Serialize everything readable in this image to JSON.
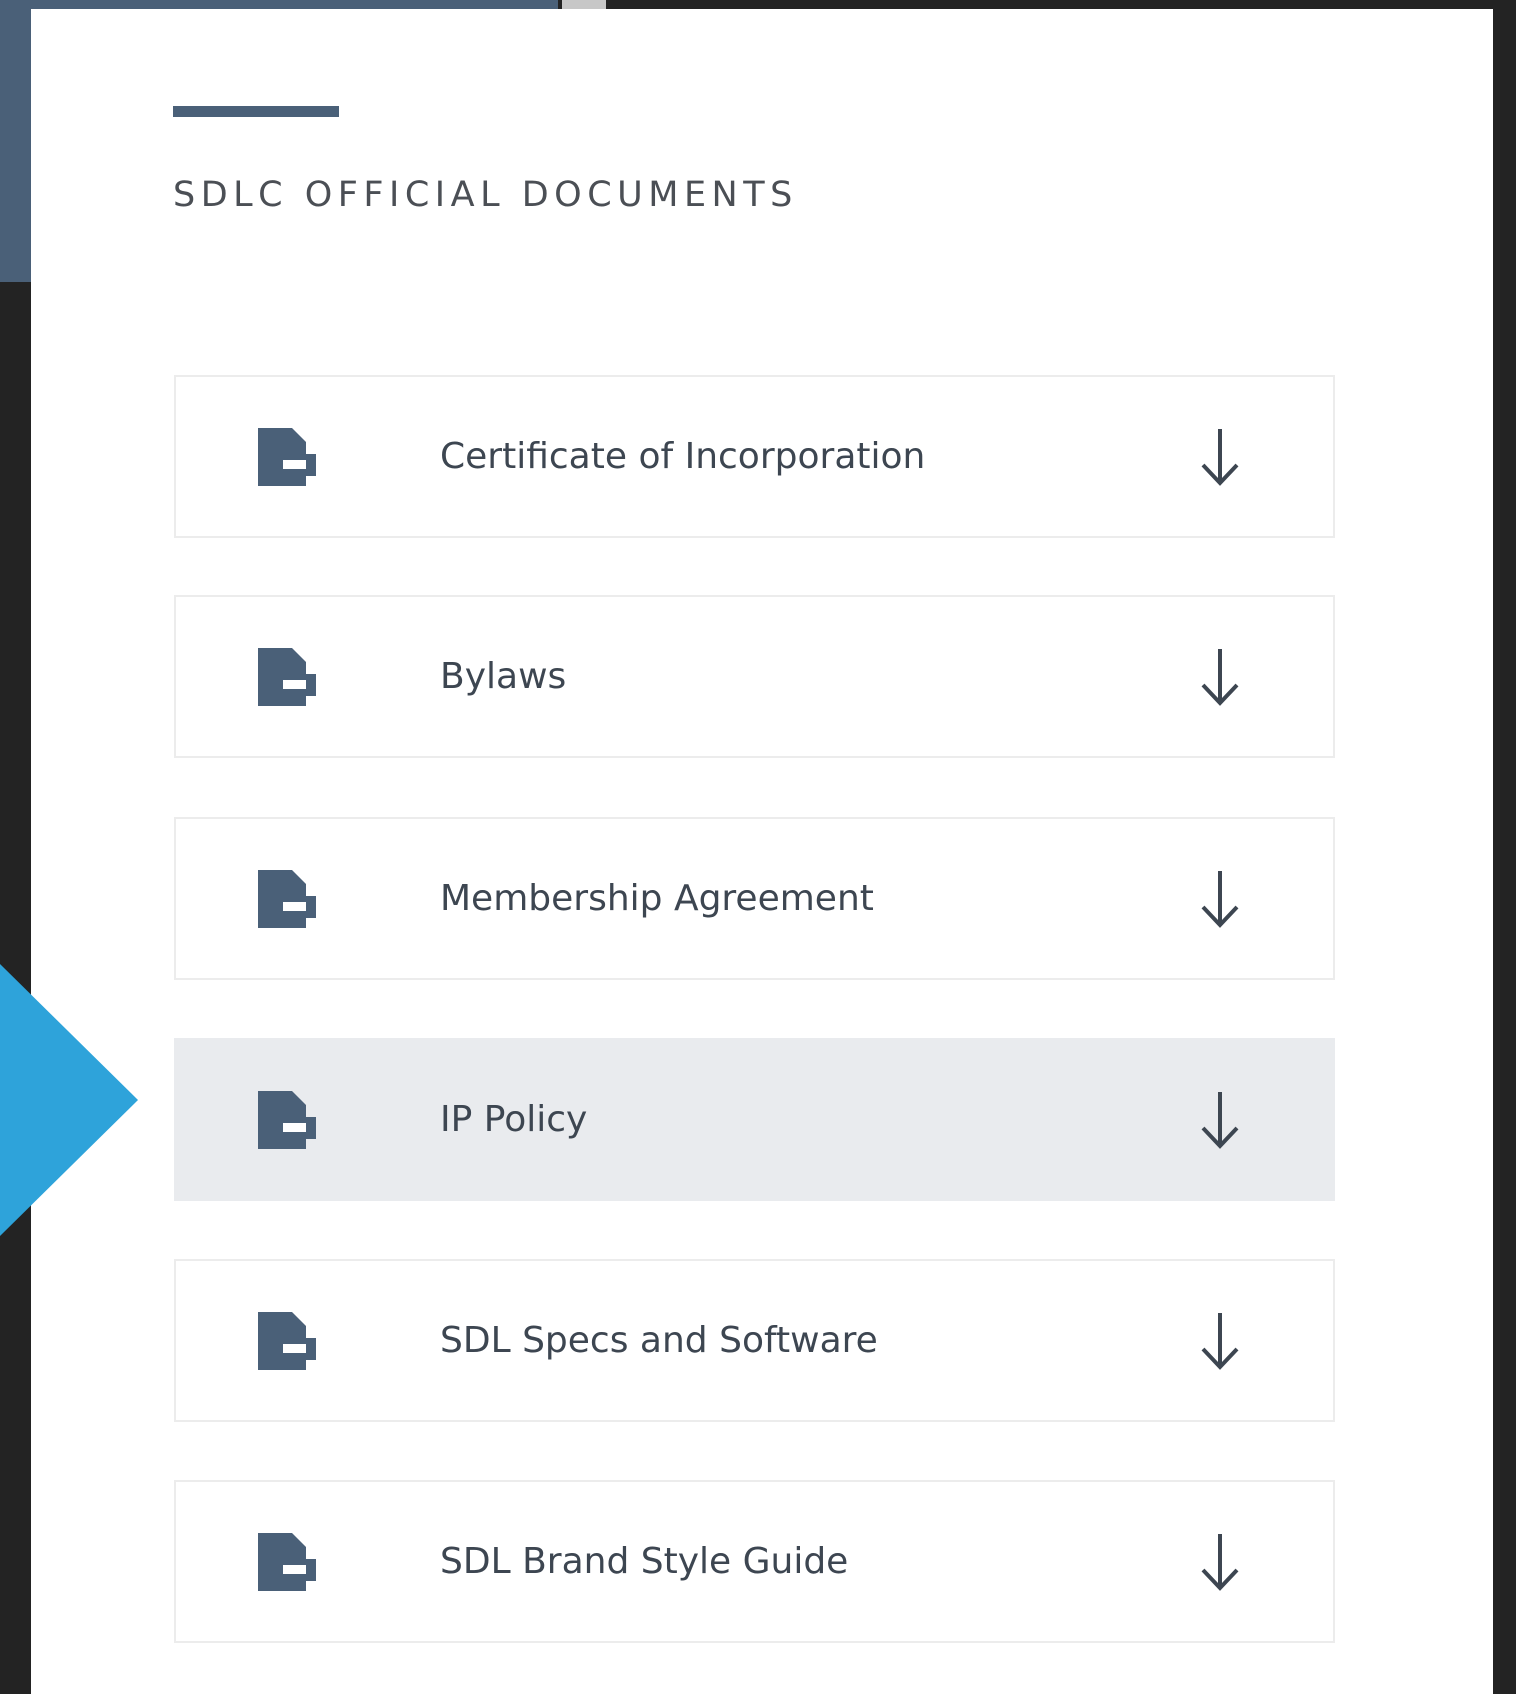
{
  "section": {
    "title": "SDLC OFFICIAL DOCUMENTS"
  },
  "documents": [
    {
      "label": "Certificate of Incorporation"
    },
    {
      "label": "Bylaws"
    },
    {
      "label": "Membership Agreement"
    },
    {
      "label": "IP Policy",
      "highlighted": true
    },
    {
      "label": "SDL Specs and Software"
    },
    {
      "label": "SDL Brand Style Guide"
    }
  ],
  "icons": {
    "document": "document-icon",
    "download": "download-arrow-icon",
    "pointer": "pointer-arrow-icon"
  },
  "colors": {
    "slate": "#4a6078",
    "pointer_blue": "#2ea3da",
    "highlight_row": "#e9ebee",
    "dark_background": "#232323"
  }
}
